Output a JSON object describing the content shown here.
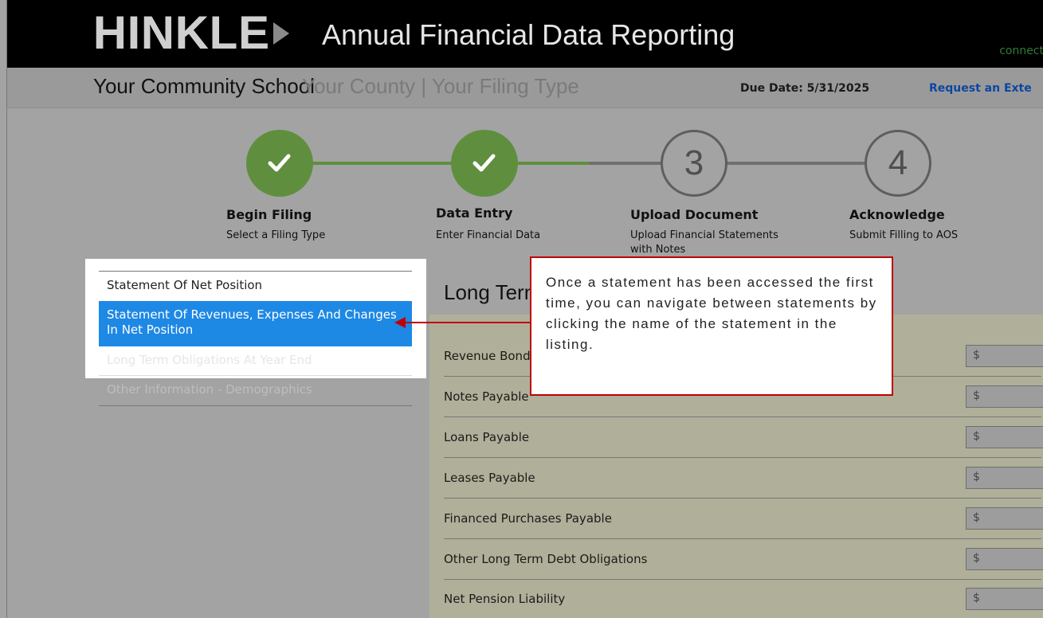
{
  "header": {
    "logo": "HINKLE",
    "app_title": "Annual Financial Data Reporting",
    "connect_text": "connect"
  },
  "subheader": {
    "school": "Your Community School",
    "county_filing": "Your County  |  Your Filing Type",
    "due_date": "Due Date: 5/31/2025",
    "request_extension": "Request an Exte"
  },
  "stepper": {
    "steps": [
      {
        "number": "1",
        "title": "Begin Filing",
        "description": "Select a Filing Type",
        "status": "complete"
      },
      {
        "number": "2",
        "title": "Data Entry",
        "description": "Enter Financial Data",
        "status": "complete"
      },
      {
        "number": "3",
        "title": "Upload Document",
        "description": "Upload Financial Statements with Notes",
        "status": "pending"
      },
      {
        "number": "4",
        "title": "Acknowledge",
        "description": "Submit Filling to AOS",
        "status": "pending"
      }
    ],
    "complete_color": "#5f8f3e"
  },
  "sidebar": {
    "items": [
      {
        "label": "Statement Of Net Position"
      },
      {
        "label": "Statement Of Revenues, Expenses And Changes In Net Position",
        "active": true
      },
      {
        "label": "Long Term Obligations At Year End"
      },
      {
        "label": "Other Information - Demographics"
      }
    ],
    "active_color": "#1e88e5"
  },
  "main": {
    "section_title": "Long Term Obligations At Year End",
    "rows": [
      {
        "label": "Revenue Bonds Payable",
        "currency": "$"
      },
      {
        "label": "Notes Payable",
        "currency": "$"
      },
      {
        "label": "Loans Payable",
        "currency": "$"
      },
      {
        "label": "Leases Payable",
        "currency": "$"
      },
      {
        "label": "Financed Purchases Payable",
        "currency": "$"
      },
      {
        "label": "Other Long Term Debt Obligations",
        "currency": "$"
      },
      {
        "label": "Net Pension Liability",
        "currency": "$"
      }
    ]
  },
  "callout": {
    "text": "Once a statement has been accessed the first time, you can navigate between statements by clicking the name of the statement in the listing.",
    "border_color": "#c00000"
  }
}
